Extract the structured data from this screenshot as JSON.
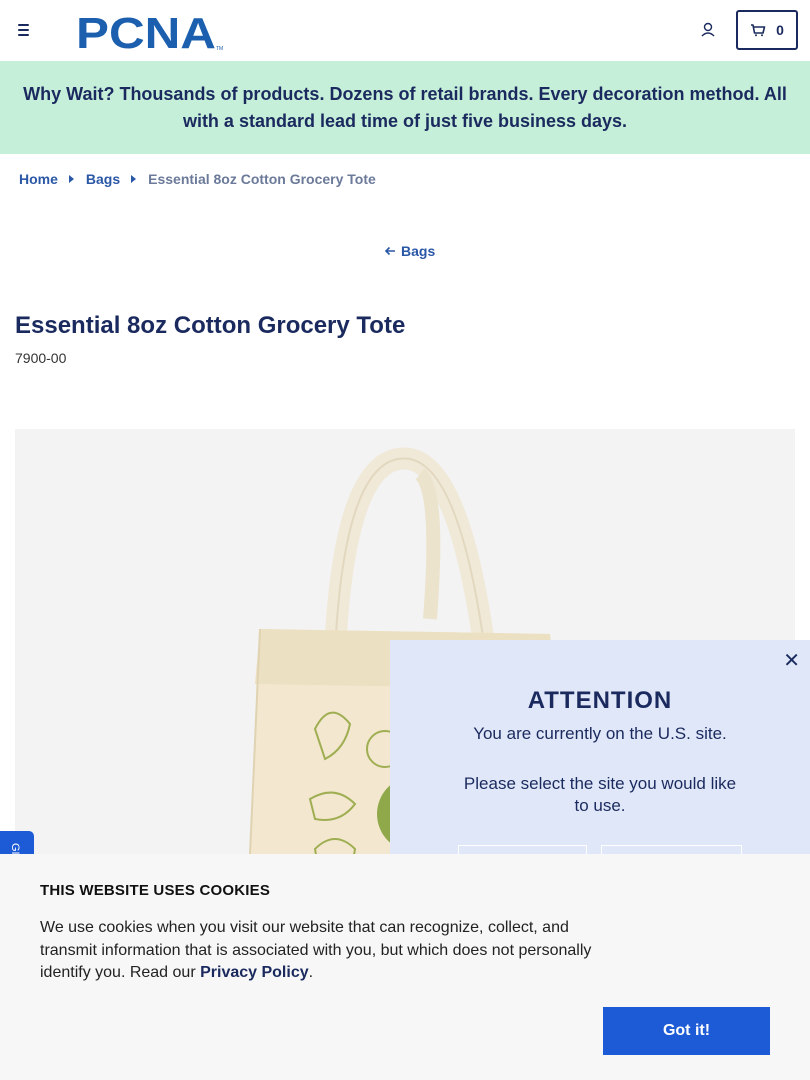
{
  "header": {
    "logo_text": "PCNA",
    "logo_tm": "TM",
    "cart_count": "0"
  },
  "promo": {
    "text": "Why Wait? Thousands of products. Dozens of retail brands. Every decoration method. All with a standard lead time of just five business days."
  },
  "breadcrumb": {
    "items": [
      "Home",
      "Bags"
    ],
    "current": "Essential 8oz Cotton Grocery Tote"
  },
  "back_link": "Bags",
  "product": {
    "title": "Essential 8oz Cotton Grocery Tote",
    "sku": "7900-00"
  },
  "side_tab": "GI",
  "modal": {
    "title": "ATTENTION",
    "line1": "You are currently on the U.S. site.",
    "line2": "Please select the site you would like to use."
  },
  "cookie": {
    "title": "THIS WEBSITE USES COOKIES",
    "text": "We use cookies when you visit our website that can recognize, collect, and transmit information that is associated with you, but which does not personally identify you. Read our ",
    "link": "Privacy Policy",
    "period": ".",
    "button": "Got it!"
  },
  "colors": {
    "navy": "#1b2a5e",
    "brand_blue": "#1d5bd6",
    "promo_bg": "#c6efd9",
    "modal_bg": "#dfe7f8"
  }
}
